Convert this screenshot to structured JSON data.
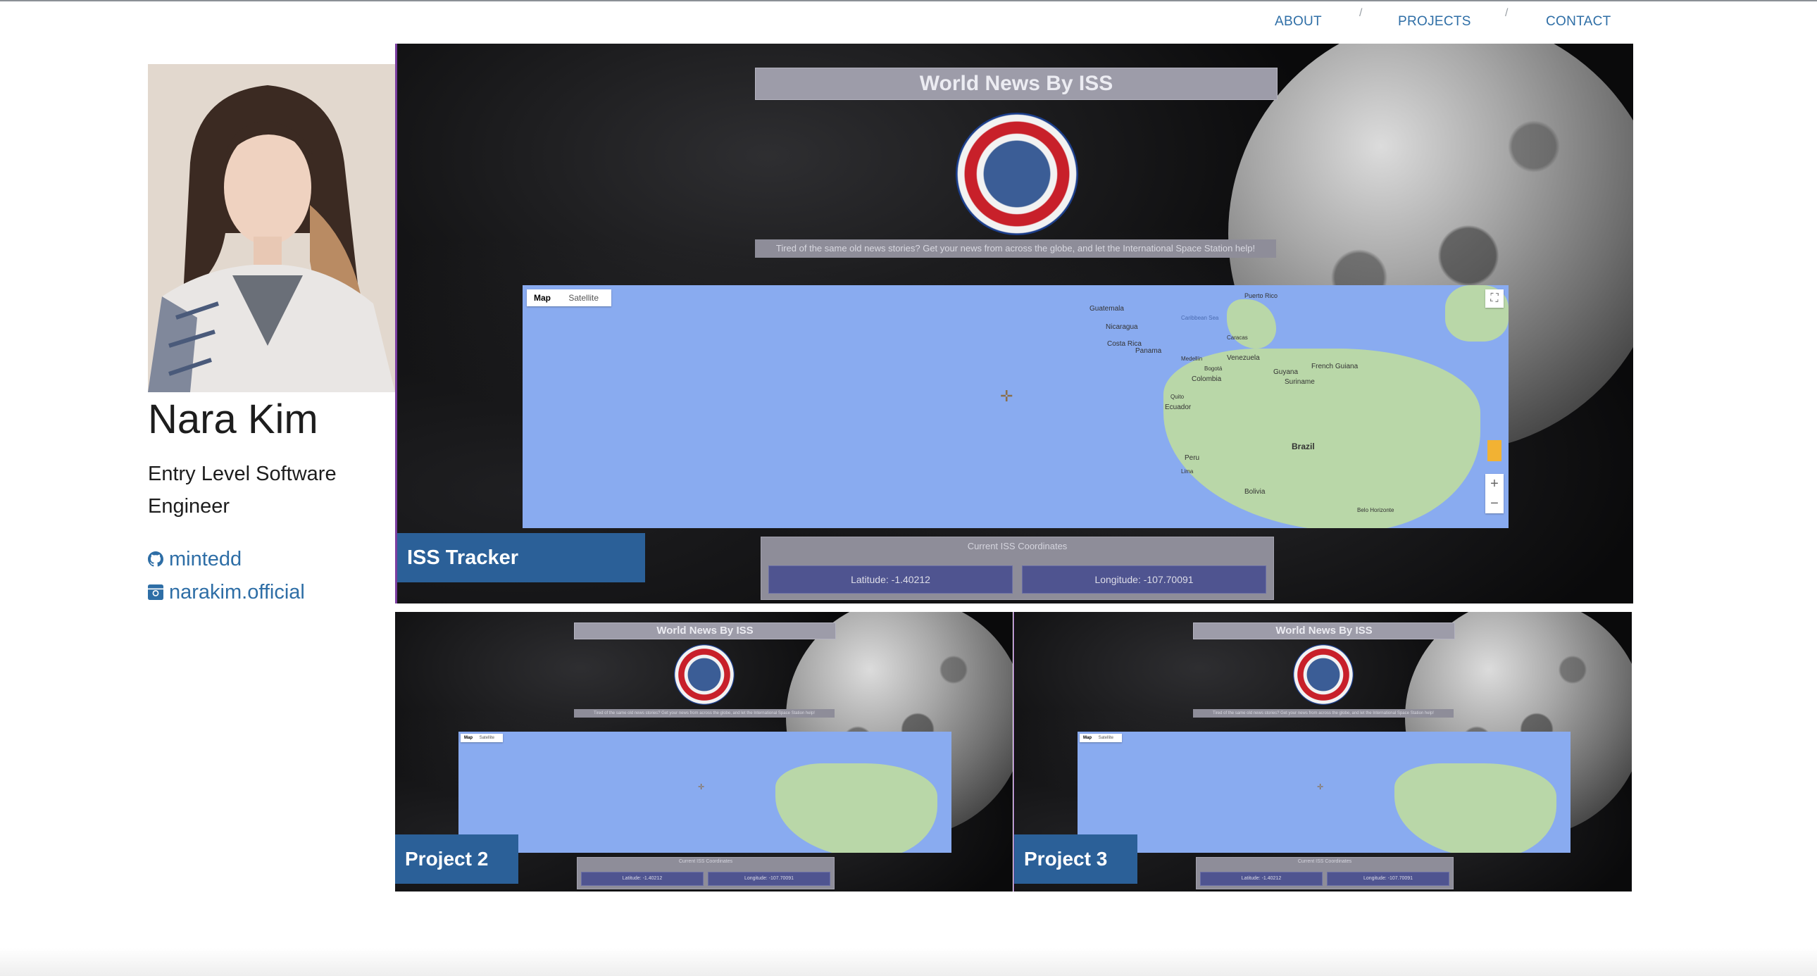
{
  "nav": {
    "items": [
      "ABOUT",
      "PROJECTS",
      "CONTACT"
    ],
    "separator": "/"
  },
  "profile": {
    "name": "Nara Kim",
    "title": "Entry Level Software Engineer",
    "links": [
      {
        "icon": "github-icon",
        "label": "mintedd"
      },
      {
        "icon": "instagram-icon",
        "label": "narakim.official"
      }
    ]
  },
  "iss_app": {
    "title": "World News By ISS",
    "tagline": "Tired of the same old news stories? Get your news from across the globe, and let the International Space Station help!",
    "map_tabs": [
      "Map",
      "Satellite"
    ],
    "map_places": [
      "Guatemala",
      "Nicaragua",
      "Costa Rica",
      "Panama",
      "Venezuela",
      "Colombia",
      "Guyana",
      "Suriname",
      "French Guiana",
      "Ecuador",
      "Peru",
      "Brazil",
      "Bolivia",
      "Puerto Rico",
      "Caracas",
      "Bogotá",
      "Quito",
      "Lima",
      "Belo Horizonte",
      "Caribbean Sea",
      "Medellín"
    ],
    "coords_label": "Current ISS Coordinates",
    "latitude": "Latitude: -1.40212",
    "longitude": "Longitude: -107.70091"
  },
  "projects": [
    {
      "label": "ISS Tracker"
    },
    {
      "label": "Project 2"
    },
    {
      "label": "Project 3"
    }
  ],
  "colors": {
    "link": "#2e6ea6",
    "label_bg": "#2b6098",
    "map_water": "#89abf0"
  }
}
